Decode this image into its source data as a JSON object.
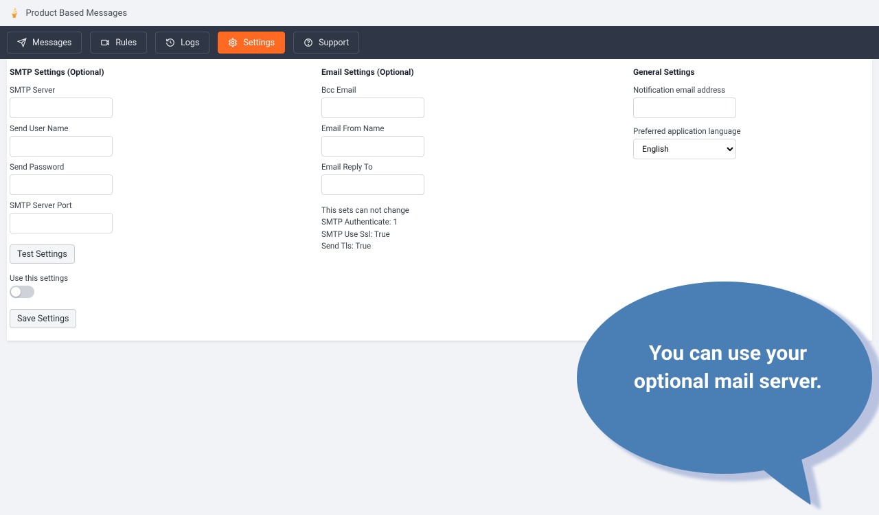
{
  "app": {
    "title": "Product Based Messages"
  },
  "nav": {
    "messages": "Messages",
    "rules": "Rules",
    "logs": "Logs",
    "settings": "Settings",
    "support": "Support"
  },
  "smtp": {
    "title": "SMTP Settings (Optional)",
    "server_label": "SMTP Server",
    "user_label": "Send User Name",
    "password_label": "Send Password",
    "port_label": "SMTP Server Port",
    "test_button": "Test Settings",
    "use_label": "Use this settings",
    "save_button": "Save Settings"
  },
  "email": {
    "title": "Email Settings (Optional)",
    "bcc_label": "Bcc Email",
    "from_label": "Email From Name",
    "reply_label": "Email Reply To",
    "note_title": "This sets can not change",
    "note_auth": "SMTP Authenticate: 1",
    "note_ssl": "SMTP Use Ssl: True",
    "note_tls": "Send Tls: True"
  },
  "general": {
    "title": "General Settings",
    "notify_label": "Notification email address",
    "lang_label": "Preferred application language",
    "lang_value": "English"
  },
  "bubble": {
    "text": "You can use your optional mail server."
  }
}
